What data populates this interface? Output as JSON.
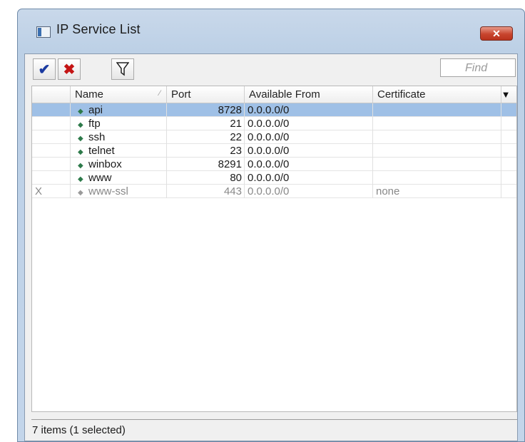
{
  "window": {
    "title": "IP Service List"
  },
  "toolbar": {
    "enable_icon": "✔",
    "disable_icon": "✖",
    "find_placeholder": "Find"
  },
  "table": {
    "columns": [
      "",
      "Name",
      "Port",
      "Available From",
      "Certificate"
    ],
    "rows": [
      {
        "flag": "",
        "name": "api",
        "port": "8728",
        "available_from": "0.0.0.0/0",
        "certificate": "",
        "selected": true,
        "disabled": false
      },
      {
        "flag": "",
        "name": "ftp",
        "port": "21",
        "available_from": "0.0.0.0/0",
        "certificate": "",
        "selected": false,
        "disabled": false
      },
      {
        "flag": "",
        "name": "ssh",
        "port": "22",
        "available_from": "0.0.0.0/0",
        "certificate": "",
        "selected": false,
        "disabled": false
      },
      {
        "flag": "",
        "name": "telnet",
        "port": "23",
        "available_from": "0.0.0.0/0",
        "certificate": "",
        "selected": false,
        "disabled": false
      },
      {
        "flag": "",
        "name": "winbox",
        "port": "8291",
        "available_from": "0.0.0.0/0",
        "certificate": "",
        "selected": false,
        "disabled": false
      },
      {
        "flag": "",
        "name": "www",
        "port": "80",
        "available_from": "0.0.0.0/0",
        "certificate": "",
        "selected": false,
        "disabled": false
      },
      {
        "flag": "X",
        "name": "www-ssl",
        "port": "443",
        "available_from": "0.0.0.0/0",
        "certificate": "none",
        "selected": false,
        "disabled": true
      }
    ]
  },
  "status": {
    "text": "7 items (1 selected)"
  },
  "colors": {
    "selection": "#9fc0e6",
    "service_icon": "#2d7a4a"
  }
}
